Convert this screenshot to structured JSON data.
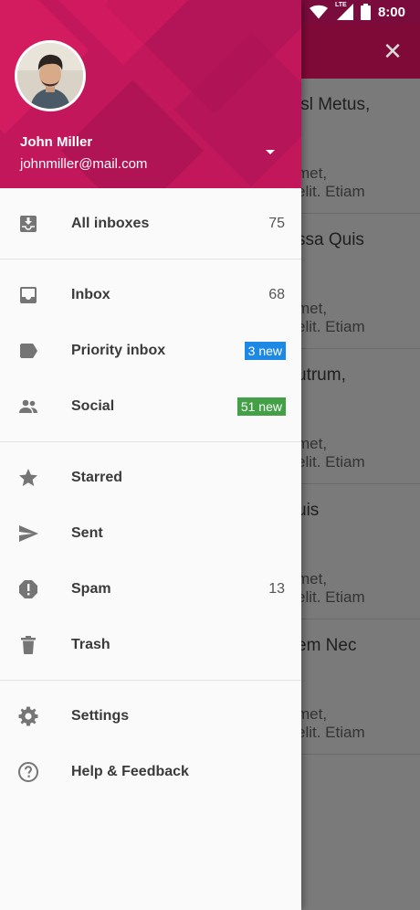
{
  "status_bar": {
    "time": "8:00",
    "network_label": "LTE",
    "icons": [
      "wifi-icon",
      "cell-signal-icon",
      "battery-icon"
    ]
  },
  "background": {
    "close_icon": "close-icon",
    "messages": [
      {
        "title": "isl Metus,",
        "line1": "met,",
        "line2": "elit. Etiam"
      },
      {
        "title": "ssa Quis",
        "line1": "met,",
        "line2": "elit. Etiam"
      },
      {
        "title": "utrum,",
        "line1": "met,",
        "line2": "elit. Etiam"
      },
      {
        "title": "uis",
        "line1": "met,",
        "line2": "elit. Etiam"
      },
      {
        "title": "em Nec",
        "line1": "met,",
        "line2": "elit. Etiam"
      }
    ]
  },
  "drawer": {
    "user": {
      "name": "John Miller",
      "email": "johnmiller@mail.com"
    },
    "colors": {
      "header": "#c2185b",
      "badge_blue": "#1e88e5",
      "badge_green": "#43a047"
    },
    "groups": [
      [
        {
          "name": "all-inboxes",
          "icon": "move-to-inbox-icon",
          "label": "All inboxes",
          "count": "75"
        }
      ],
      [
        {
          "name": "inbox",
          "icon": "inbox-icon",
          "label": "Inbox",
          "count": "68"
        },
        {
          "name": "priority-inbox",
          "icon": "label-icon",
          "label": "Priority inbox",
          "badge": "3 new",
          "badge_color": "#1e88e5"
        },
        {
          "name": "social",
          "icon": "people-icon",
          "label": "Social",
          "badge": "51 new",
          "badge_color": "#43a047"
        }
      ],
      [
        {
          "name": "starred",
          "icon": "star-icon",
          "label": "Starred"
        },
        {
          "name": "sent",
          "icon": "send-icon",
          "label": "Sent"
        },
        {
          "name": "spam",
          "icon": "report-icon",
          "label": "Spam",
          "count": "13"
        },
        {
          "name": "trash",
          "icon": "trash-icon",
          "label": "Trash"
        }
      ],
      [
        {
          "name": "settings",
          "icon": "gear-icon",
          "label": "Settings"
        },
        {
          "name": "help-feedback",
          "icon": "help-icon",
          "label": "Help & Feedback"
        }
      ]
    ]
  }
}
